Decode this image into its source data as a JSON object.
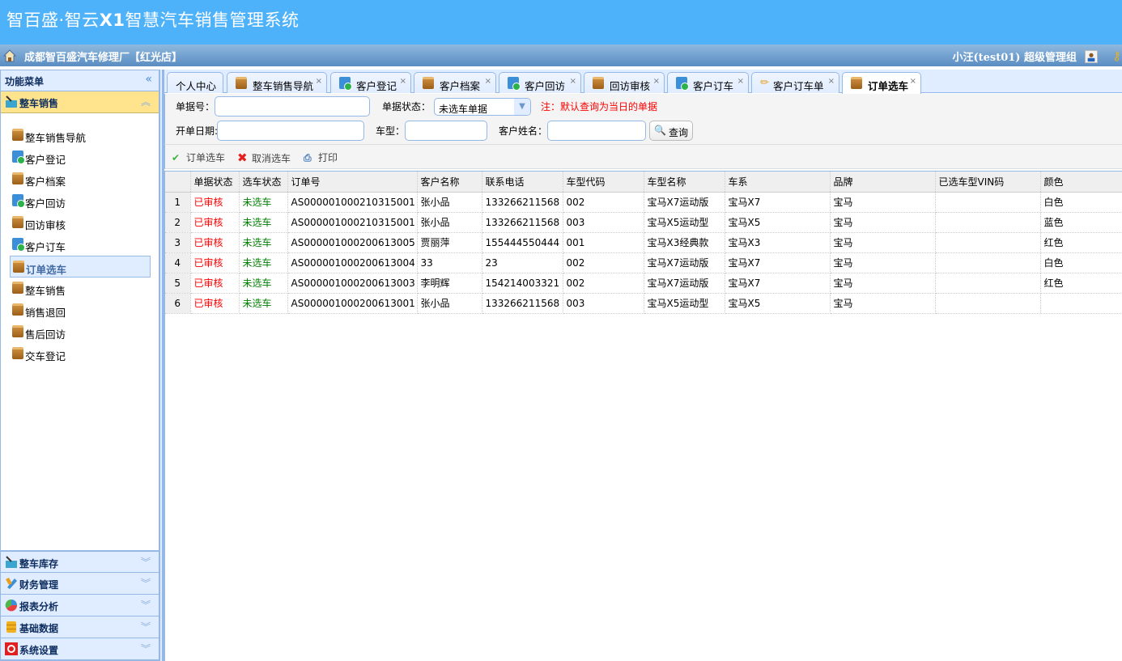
{
  "header": {
    "app_title_pre": "智百盛·智云",
    "app_title_bold": "X1",
    "app_title_post": "智慧汽车销售管理系统",
    "shop_name": "成都智百盛汽车修理厂【红光店】",
    "user_info": "小汪(test01)  超级管理组"
  },
  "sidebar": {
    "title": "功能菜单",
    "collapse_icon": "«",
    "open_section": {
      "label": "整车销售",
      "icon": "cart-icon",
      "arrow": "︽"
    },
    "items": [
      {
        "label": "整车销售导航",
        "icon": "bag"
      },
      {
        "label": "客户登记",
        "icon": "shop"
      },
      {
        "label": "客户档案",
        "icon": "bag"
      },
      {
        "label": "客户回访",
        "icon": "shop"
      },
      {
        "label": "回访审核",
        "icon": "bag"
      },
      {
        "label": "客户订车",
        "icon": "shop"
      },
      {
        "label": "订单选车",
        "icon": "bag",
        "active": true
      },
      {
        "label": "整车销售",
        "icon": "bag"
      },
      {
        "label": "销售退回",
        "icon": "bag"
      },
      {
        "label": "售后回访",
        "icon": "bag"
      },
      {
        "label": "交车登记",
        "icon": "bag"
      }
    ],
    "sections": [
      {
        "label": "整车库存",
        "icon": "cart-icon"
      },
      {
        "label": "财务管理",
        "icon": "pencil-icon"
      },
      {
        "label": "报表分析",
        "icon": "pie-chart-icon"
      },
      {
        "label": "基础数据",
        "icon": "database-icon"
      },
      {
        "label": "系统设置",
        "icon": "settings-icon"
      }
    ],
    "section_arrow": "︾"
  },
  "tabs": [
    {
      "label": "个人中心",
      "icon": "",
      "closable": false
    },
    {
      "label": "整车销售导航",
      "icon": "bag",
      "closable": true
    },
    {
      "label": "客户登记",
      "icon": "shop",
      "closable": true
    },
    {
      "label": "客户档案",
      "icon": "bag",
      "closable": true
    },
    {
      "label": "客户回访",
      "icon": "shop",
      "closable": true
    },
    {
      "label": "回访审核",
      "icon": "bag",
      "closable": true
    },
    {
      "label": "客户订车",
      "icon": "shop",
      "closable": true
    },
    {
      "label": "客户订车单",
      "icon": "pencil",
      "closable": true
    },
    {
      "label": "订单选车",
      "icon": "bag",
      "closable": true,
      "active": true
    }
  ],
  "tab_close": "×",
  "form": {
    "doc_no_label": "单据号：",
    "doc_no_value": "",
    "status_label": "单据状态：",
    "status_value": "未选车单据",
    "note": "注：默认查询为当日的单据",
    "date_label": "开单日期:",
    "date_value": "",
    "model_label": "车型：",
    "model_value": "",
    "customer_label": "客户姓名：",
    "customer_value": "",
    "search_label": "查询"
  },
  "toolbar": {
    "select_car": "订单选车",
    "cancel_select": "取消选车",
    "print": "打印"
  },
  "grid": {
    "columns": [
      "单据状态",
      "选车状态",
      "订单号",
      "客户名称",
      "联系电话",
      "车型代码",
      "车型名称",
      "车系",
      "品牌",
      "已选车型VIN码",
      "颜色"
    ],
    "rows": [
      {
        "n": "1",
        "status": "已审核",
        "select": "未选车",
        "order": "AS000001000210315001",
        "customer": "张小品",
        "phone": "133266211568",
        "code": "002",
        "model": "宝马X7运动版",
        "series": "宝马X7",
        "brand": "宝马",
        "vin": "",
        "color": "白色"
      },
      {
        "n": "2",
        "status": "已审核",
        "select": "未选车",
        "order": "AS000001000210315001",
        "customer": "张小品",
        "phone": "133266211568",
        "code": "003",
        "model": "宝马X5运动型",
        "series": "宝马X5",
        "brand": "宝马",
        "vin": "",
        "color": "蓝色"
      },
      {
        "n": "3",
        "status": "已审核",
        "select": "未选车",
        "order": "AS000001000200613005",
        "customer": "贾丽萍",
        "phone": "155444550444",
        "code": "001",
        "model": "宝马X3经典款",
        "series": "宝马X3",
        "brand": "宝马",
        "vin": "",
        "color": "红色"
      },
      {
        "n": "4",
        "status": "已审核",
        "select": "未选车",
        "order": "AS000001000200613004",
        "customer": "33",
        "phone": "23",
        "code": "002",
        "model": "宝马X7运动版",
        "series": "宝马X7",
        "brand": "宝马",
        "vin": "",
        "color": "白色"
      },
      {
        "n": "5",
        "status": "已审核",
        "select": "未选车",
        "order": "AS000001000200613003",
        "customer": "李明辉",
        "phone": "154214003321",
        "code": "002",
        "model": "宝马X7运动版",
        "series": "宝马X7",
        "brand": "宝马",
        "vin": "",
        "color": "红色"
      },
      {
        "n": "6",
        "status": "已审核",
        "select": "未选车",
        "order": "AS000001000200613001",
        "customer": "张小品",
        "phone": "133266211568",
        "code": "003",
        "model": "宝马X5运动型",
        "series": "宝马X5",
        "brand": "宝马",
        "vin": "",
        "color": ""
      }
    ]
  },
  "colors": {
    "header_bg": "#4eb2fa",
    "status_red": "#ff0000",
    "status_green": "#008000",
    "border_blue": "#95b8e7",
    "active_section": "#ffe48d"
  }
}
